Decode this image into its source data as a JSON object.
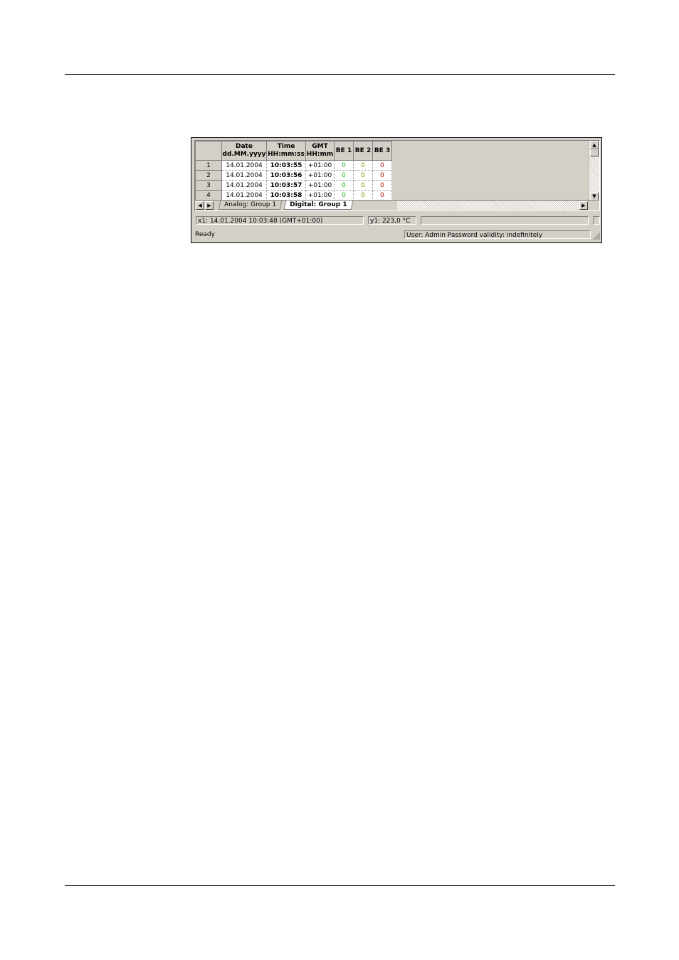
{
  "table": {
    "headers": [
      {
        "line1": "",
        "line2": ""
      },
      {
        "line1": "Date",
        "line2": "dd.MM.yyyy"
      },
      {
        "line1": "Time",
        "line2": "HH:mm:ss"
      },
      {
        "line1": "GMT",
        "line2": "HH:mm"
      },
      {
        "line1": "BE 1",
        "line2": ""
      },
      {
        "line1": "BE 2",
        "line2": ""
      },
      {
        "line1": "BE 3",
        "line2": ""
      }
    ],
    "rows": [
      {
        "n": "1",
        "date": "14.01.2004",
        "time": "10:03:55",
        "gmt": "+01:00",
        "be1": "0",
        "be2": "0",
        "be3": "0"
      },
      {
        "n": "2",
        "date": "14.01.2004",
        "time": "10:03:56",
        "gmt": "+01:00",
        "be1": "0",
        "be2": "0",
        "be3": "0"
      },
      {
        "n": "3",
        "date": "14.01.2004",
        "time": "10:03:57",
        "gmt": "+01:00",
        "be1": "0",
        "be2": "0",
        "be3": "0"
      },
      {
        "n": "4",
        "date": "14.01.2004",
        "time": "10:03:58",
        "gmt": "+01:00",
        "be1": "0",
        "be2": "0",
        "be3": "0"
      }
    ],
    "value_colors": {
      "be1": "#22b022",
      "be2": "#8a8a00",
      "be3": "#b00000"
    }
  },
  "tabs": [
    {
      "label": "Analog: Group 1",
      "active": false
    },
    {
      "label": "Digital: Group 1",
      "active": true
    }
  ],
  "cursor": {
    "x_readout": "x1: 14.01.2004 10:03:48 (GMT+01:00)",
    "y_readout": "y1: 223,0 °C"
  },
  "statusbar": {
    "ready": "Ready",
    "user": "User: Admin   Password validity: indefinitely"
  },
  "icons": {
    "scroll_up": "arrow-up-icon",
    "scroll_down": "arrow-down-icon",
    "scroll_left": "arrow-left-icon",
    "scroll_right": "arrow-right-icon"
  }
}
